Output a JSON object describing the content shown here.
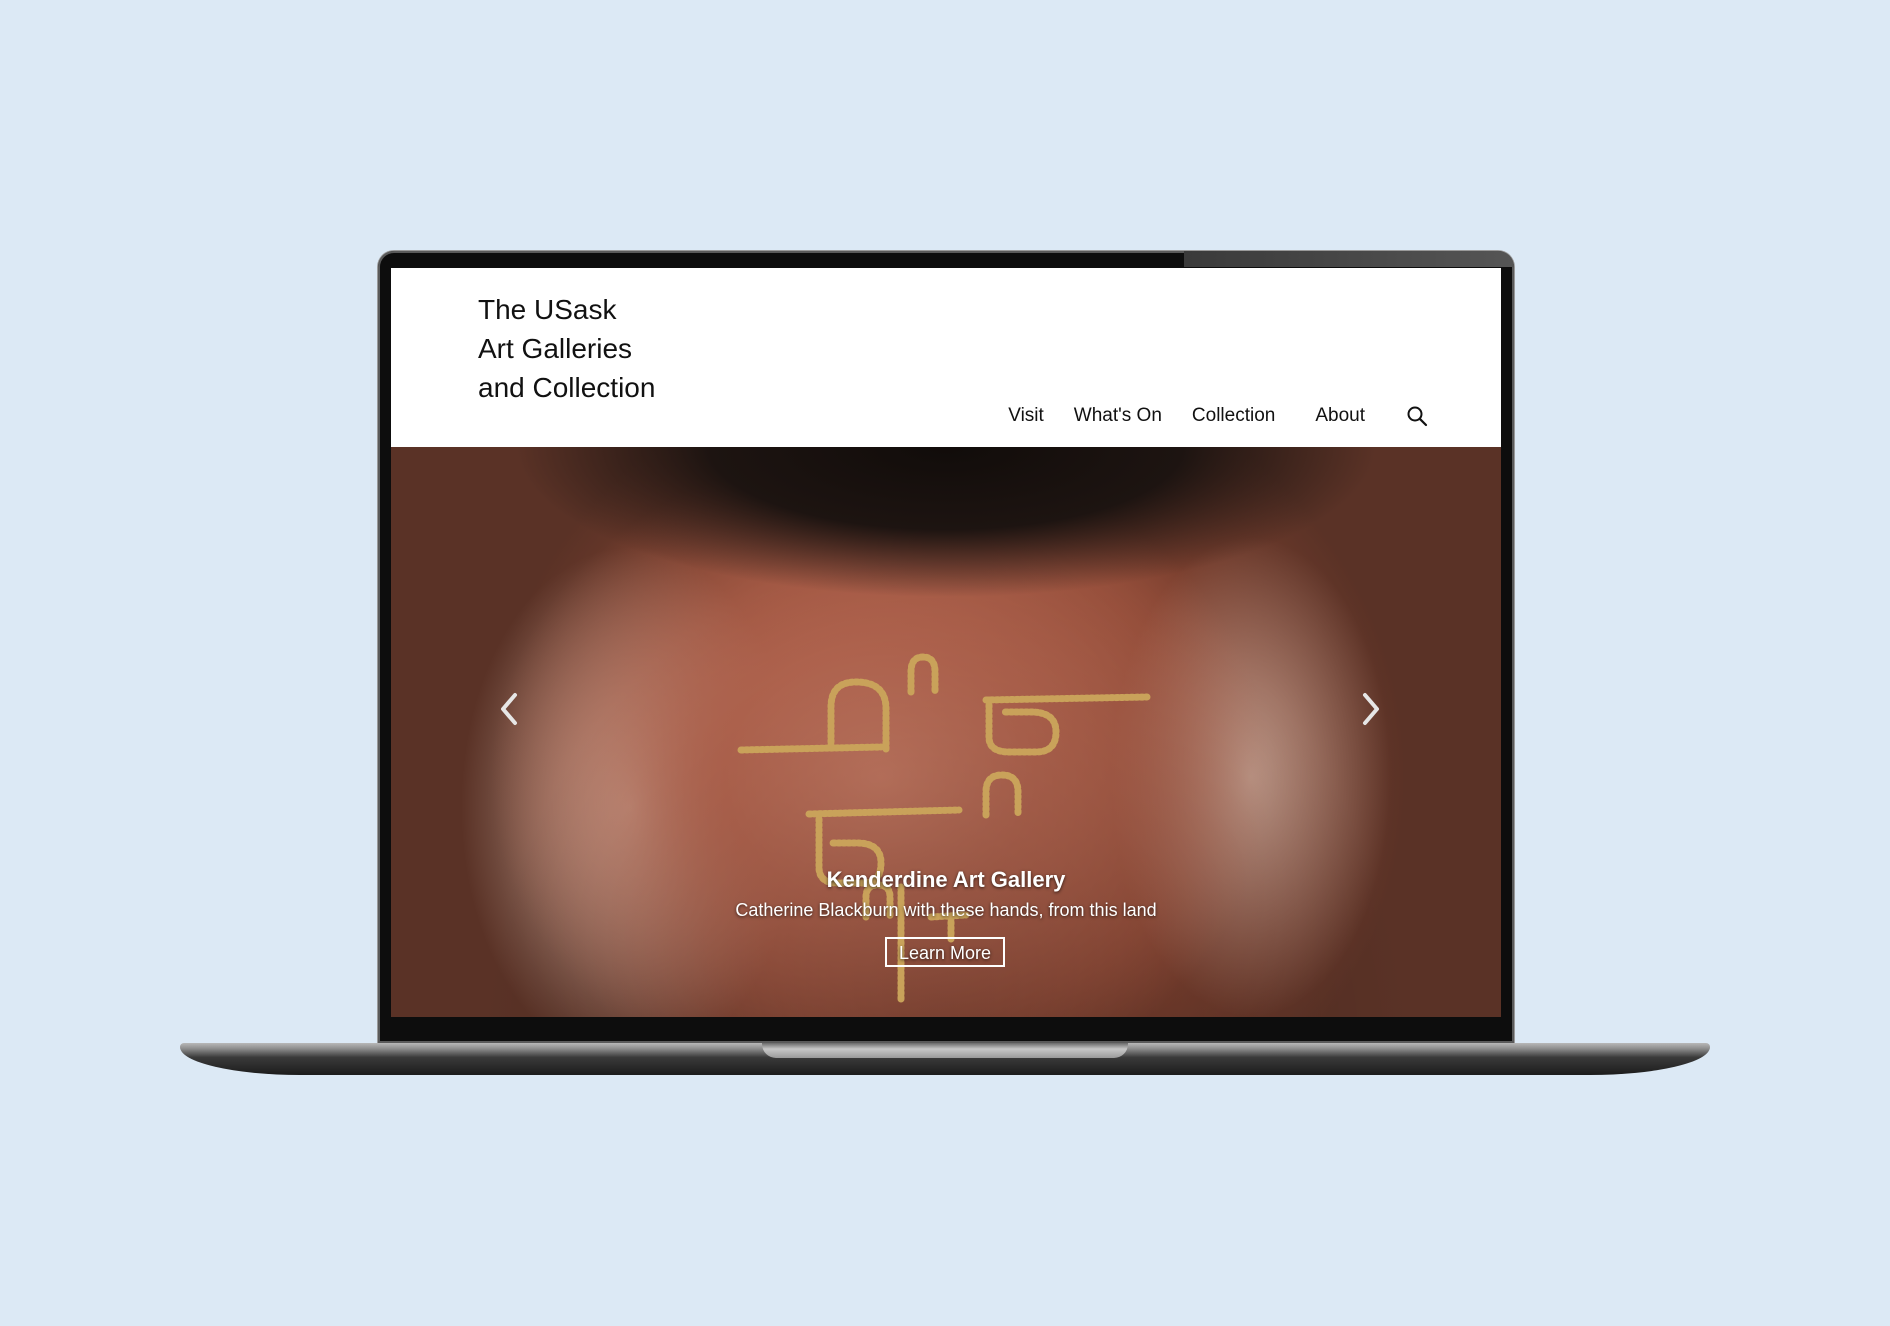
{
  "header": {
    "logo_lines": [
      "The USask",
      "Art Galleries",
      "and Collection"
    ]
  },
  "nav": {
    "items": [
      {
        "label": "Visit"
      },
      {
        "label": "What's On"
      },
      {
        "label": "Collection"
      },
      {
        "label": "About"
      }
    ],
    "search_icon": "search-icon"
  },
  "hero": {
    "title": "Kenderdine Art Gallery",
    "subtitle": "Catherine Blackburn with these hands, from this land",
    "button_label": "Learn More",
    "prev_icon": "chevron-left-icon",
    "next_icon": "chevron-right-icon"
  },
  "colors": {
    "page_background": "#dce9f5",
    "header_background": "#ffffff",
    "text": "#111111",
    "caption_text": "#ffffff",
    "bead_gold": "#c9a25a"
  }
}
